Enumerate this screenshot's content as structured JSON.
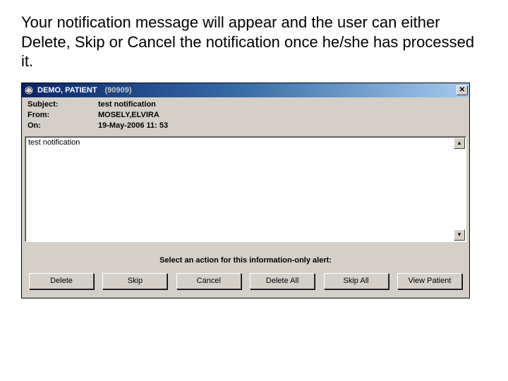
{
  "caption": "Your notification message will appear and the user can either Delete, Skip or Cancel the notification once he/she has processed it.",
  "dialog": {
    "title_main": "DEMO, PATIENT",
    "title_id": "(90909)",
    "close_glyph": "✕",
    "scroll_up_glyph": "▴",
    "scroll_down_glyph": "▾",
    "info": {
      "labels": {
        "subject": "Subject:",
        "from": "From:",
        "on": "On:"
      },
      "values": {
        "subject": "test notification",
        "from": "MOSELY,ELVIRA",
        "on": "19-May-2006 11: 53"
      }
    },
    "body_text": "test notification",
    "prompt": "Select an action for this information-only alert:",
    "buttons": {
      "delete": "Delete",
      "skip": "Skip",
      "cancel": "Cancel",
      "delete_all": "Delete All",
      "skip_all": "Skip All",
      "view_patient": "View Patient"
    }
  }
}
